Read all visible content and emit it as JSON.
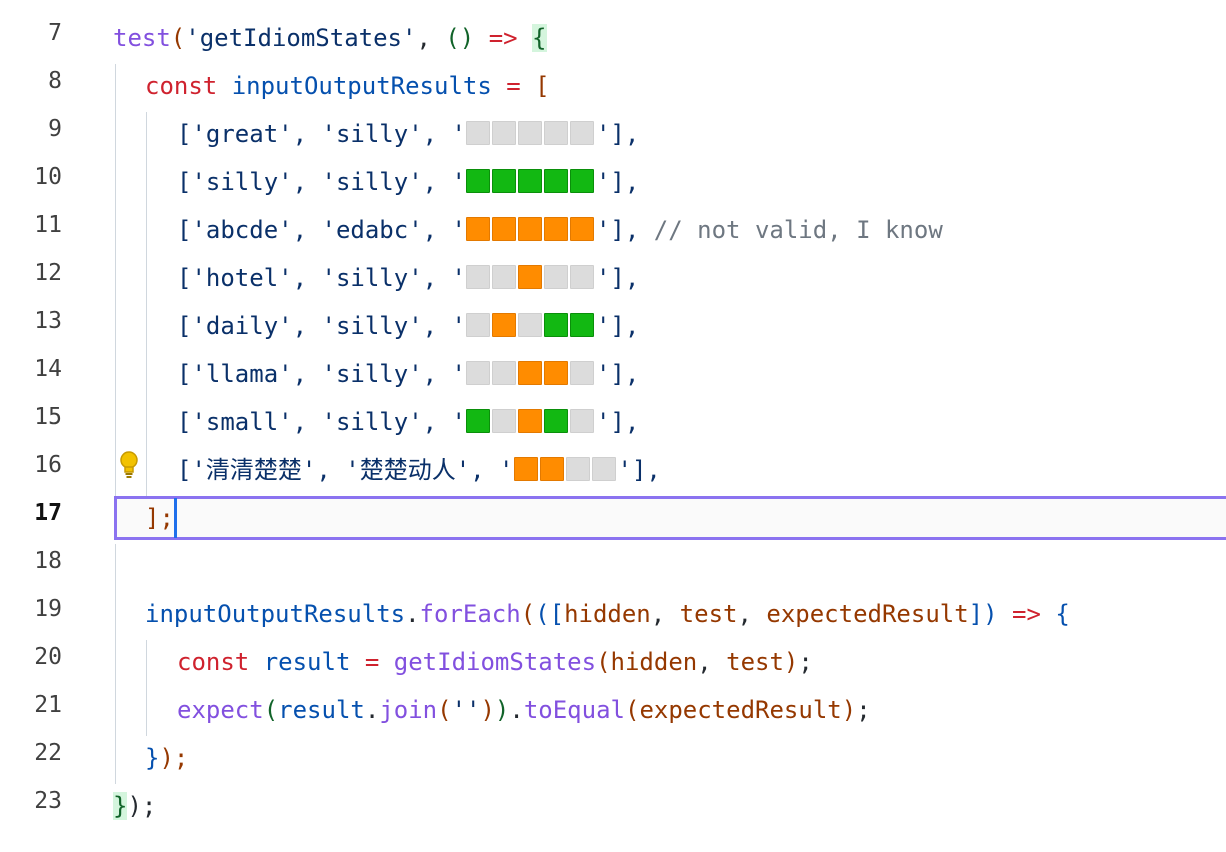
{
  "gutter": [
    "7",
    "8",
    "9",
    "10",
    "11",
    "12",
    "13",
    "14",
    "15",
    "16",
    "17",
    "18",
    "19",
    "20",
    "21",
    "22",
    "23"
  ],
  "code": {
    "l7": {
      "t1": "test",
      "t2": "(",
      "t3": "'getIdiomStates'",
      "t4": ", ",
      "t5": "()",
      "t6": " => ",
      "t7": "{"
    },
    "l8": {
      "t1": "const ",
      "t2": "inputOutputResults",
      "t3": " = ",
      "t4": "["
    },
    "rows": [
      {
        "open": "['great', 'silly', '",
        "close": "'],"
      },
      {
        "open": "['silly', 'silly', '",
        "close": "'],"
      },
      {
        "open": "['abcde', 'edabc', '",
        "close": "'],",
        "comment": " // not valid, I know"
      },
      {
        "open": "['hotel', 'silly', '",
        "close": "'],"
      },
      {
        "open": "['daily', 'silly', '",
        "close": "'],"
      },
      {
        "open": "['llama', 'silly', '",
        "close": "'],"
      },
      {
        "open": "['small', 'silly', '",
        "close": "'],"
      },
      {
        "open": "['清清楚楚', '楚楚动人', '",
        "close": "'],"
      }
    ],
    "l17": "];",
    "l19": {
      "t1": "inputOutputResults",
      "t2": ".",
      "t3": "forEach",
      "t4": "(",
      "t5": "([",
      "t6": "hidden",
      "t7": ", ",
      "t8": "test",
      "t9": ", ",
      "t10": "expectedResult",
      "t11": "])",
      "t12": " => ",
      "t13": "{"
    },
    "l20": {
      "t1": "const ",
      "t2": "result",
      "t3": " = ",
      "t4": "getIdiomStates",
      "t5": "(",
      "t6": "hidden",
      "t7": ", ",
      "t8": "test",
      "t9": ")",
      "t10": ";"
    },
    "l21": {
      "t1": "expect",
      "t2": "(",
      "t3": "result",
      "t4": ".",
      "t5": "join",
      "t6": "(",
      "t7": "''",
      "t8": ")",
      "t9": ")",
      "t10": ".",
      "t11": "toEqual",
      "t12": "(",
      "t13": "expectedResult",
      "t14": ")",
      "t15": ";"
    },
    "l22": {
      "t1": "}",
      "t2": ");"
    },
    "l23": {
      "t1": "}",
      "t2": ");"
    }
  },
  "colors": {
    "green": "#12b812",
    "orange": "#ff8c00",
    "gray": "#dcdcdc"
  },
  "icons": {
    "lightbulb": "lightbulb-icon"
  }
}
